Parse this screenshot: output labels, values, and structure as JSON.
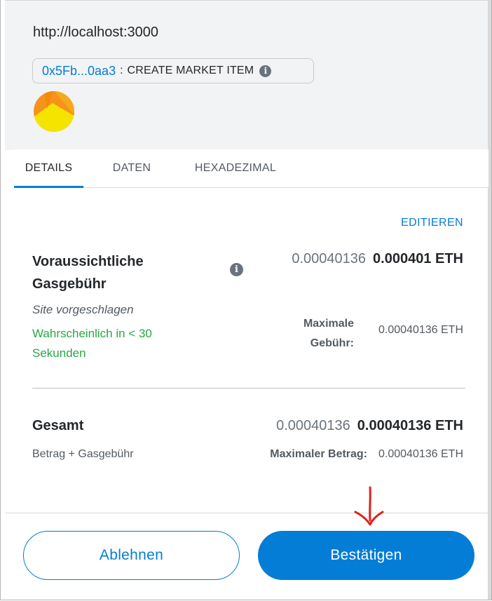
{
  "origin": "http://localhost:3000",
  "contract": {
    "address": "0x5Fb...0aa3",
    "separator": ":",
    "method": "CREATE MARKET ITEM",
    "info_icon": "i"
  },
  "tabs": [
    {
      "label": "DETAILS",
      "active": true
    },
    {
      "label": "DATEN",
      "active": false
    },
    {
      "label": "HEXADEZIMAL",
      "active": false
    }
  ],
  "edit_label": "EDITIEREN",
  "gas": {
    "title": "Voraussichtliche Gasgebühr",
    "info_icon": "i",
    "value_muted": "0.00040136",
    "value_strong": "0.000401 ETH",
    "suggested_by": "Site vorgeschlagen",
    "likely_text": "Wahrscheinlich in < 30 Sekunden",
    "max_fee_label": "Maximale Gebühr:",
    "max_fee_value": "0.00040136 ETH"
  },
  "total": {
    "title": "Gesamt",
    "value_muted": "0.00040136",
    "value_strong": "0.00040136 ETH",
    "subtitle": "Betrag + Gasgebühr",
    "max_amount_label": "Maximaler Betrag:",
    "max_amount_value": "0.00040136 ETH"
  },
  "buttons": {
    "reject": "Ablehnen",
    "confirm": "Bestätigen"
  },
  "colors": {
    "accent": "#037dd6",
    "success": "#28a745",
    "annotation_arrow": "#e0201b",
    "avatar_orange": "#f7931a",
    "avatar_yellow": "#f5e400"
  }
}
